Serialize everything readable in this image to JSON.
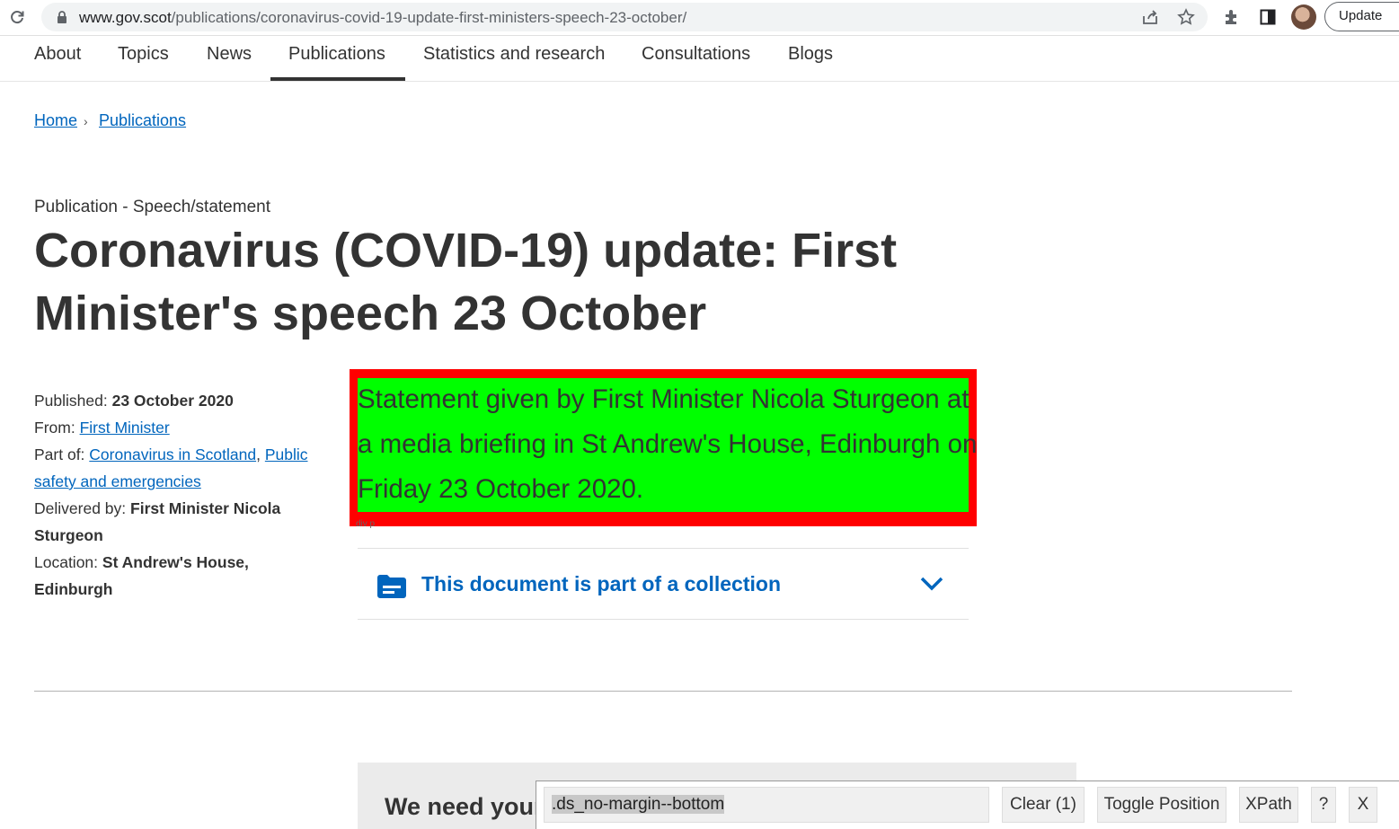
{
  "browser": {
    "url_domain": "www.gov.scot",
    "url_path": "/publications/coronavirus-covid-19-update-first-ministers-speech-23-october/",
    "update_label": "Update"
  },
  "nav": {
    "items": [
      "About",
      "Topics",
      "News",
      "Publications",
      "Statistics and research",
      "Consultations",
      "Blogs"
    ],
    "active": "Publications"
  },
  "breadcrumb": {
    "home": "Home",
    "current": "Publications",
    "separator": "›"
  },
  "page": {
    "eyebrow": "Publication - Speech/statement",
    "title": "Coronavirus (COVID-19) update: First Minister's speech 23 October"
  },
  "meta": {
    "published_label": "Published:",
    "published_value": "23 October 2020",
    "from_label": "From:",
    "from_value": "First Minister",
    "partof_label": "Part of:",
    "partof_link1": "Coronavirus in Scotland",
    "partof_comma": ",",
    "partof_link2": "Public safety and emergencies",
    "delivered_label": "Delivered by:",
    "delivered_value": "First Minister Nicola Sturgeon",
    "location_label": "Location:",
    "location_value": "St Andrew's House, Edinburgh"
  },
  "summary": {
    "text": "Statement given by First Minister Nicola Sturgeon at a media briefing in St Andrew's House, Edinburgh on Friday 23 October 2020.",
    "element_label": "div p"
  },
  "collection": {
    "label": "This document is part of a collection"
  },
  "feedback": {
    "text": "We need your"
  },
  "gadget": {
    "selector": ".ds_no-margin--bottom",
    "clear_label": "Clear (1)",
    "toggle_label": "Toggle Position",
    "xpath_label": "XPath",
    "help_label": "?",
    "close_label": "X"
  },
  "colors": {
    "link": "#0065bd",
    "highlight_border": "#ff0000",
    "highlight_fill": "#00ff00"
  }
}
